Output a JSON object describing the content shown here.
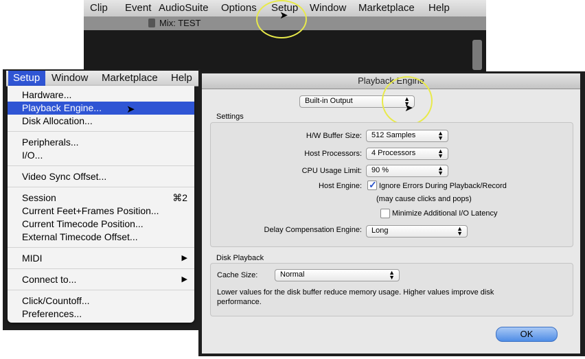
{
  "top_menu": [
    "Clip",
    "Event",
    "AudioSuite",
    "Options",
    "Setup",
    "Window",
    "Marketplace",
    "Help"
  ],
  "mix_window": {
    "title": "Mix: TEST"
  },
  "left_menubar": [
    "Window",
    "Marketplace",
    "Help"
  ],
  "setup_menu": {
    "title": "Setup",
    "items": {
      "hardware": "Hardware...",
      "playback_engine": "Playback Engine...",
      "disk_allocation": "Disk Allocation...",
      "peripherals": "Peripherals...",
      "io": "I/O...",
      "video_sync": "Video Sync Offset...",
      "session": "Session",
      "session_shortcut": "⌘2",
      "feet_frames": "Current Feet+Frames Position...",
      "timecode": "Current Timecode Position...",
      "ext_timecode": "External Timecode Offset...",
      "midi": "MIDI",
      "connect": "Connect to...",
      "click": "Click/Countoff...",
      "preferences": "Preferences..."
    },
    "submenu_arrow": "▶"
  },
  "dialog": {
    "title": "Playback Engine",
    "device": "Built-in Output",
    "settings_label": "Settings",
    "hw_buffer_label": "H/W Buffer Size:",
    "hw_buffer_value": "512 Samples",
    "host_processors_label": "Host Processors:",
    "host_processors_value": "4 Processors",
    "cpu_limit_label": "CPU Usage Limit:",
    "cpu_limit_value": "90 %",
    "host_engine_label": "Host Engine:",
    "ignore_errors_label": "Ignore Errors During Playback/Record",
    "ignore_errors_checked": true,
    "may_cause": "(may cause clicks and pops)",
    "minimize_latency_label": "Minimize Additional I/O Latency",
    "minimize_latency_checked": false,
    "delay_comp_label": "Delay Compensation Engine:",
    "delay_comp_value": "Long",
    "disk_playback_label": "Disk Playback",
    "cache_size_label": "Cache Size:",
    "cache_size_value": "Normal",
    "disk_note": "Lower values for the disk buffer reduce memory usage.  Higher values improve disk performance.",
    "ok": "OK"
  },
  "colors": {
    "menu_highlight": "#2f55d4",
    "ok_button": "#5a95e8",
    "highlight_ring": "#e8ea4a"
  },
  "icons": {
    "popup": "updown-arrows-icon",
    "cursor": "arrow-cursor-icon",
    "checkmark": "checkmark-icon"
  }
}
